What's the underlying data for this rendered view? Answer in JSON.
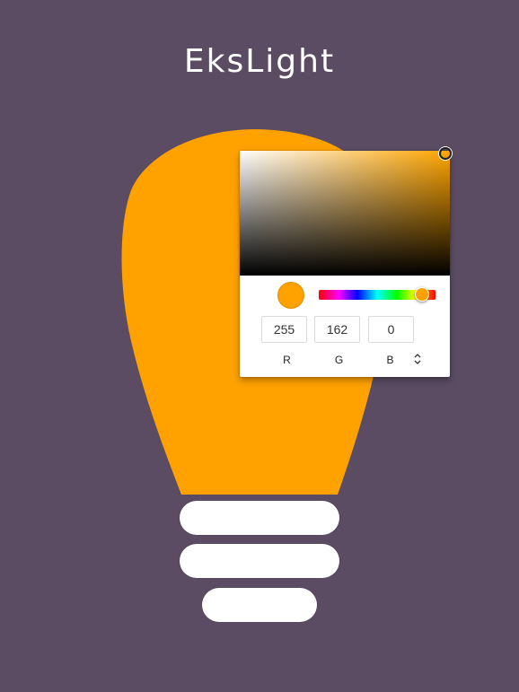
{
  "app": {
    "title": "EksLight"
  },
  "colors": {
    "background": "#5b4c63",
    "bulb": "#ffa200",
    "base": "#ffffff"
  },
  "color_picker": {
    "current_color": "#ffa200",
    "hue_color": "#ffa500",
    "r_value": "255",
    "g_value": "162",
    "b_value": "0",
    "r_label": "R",
    "g_label": "G",
    "b_label": "B",
    "mode_toggle_icon": "up-down-chevron-icon"
  }
}
